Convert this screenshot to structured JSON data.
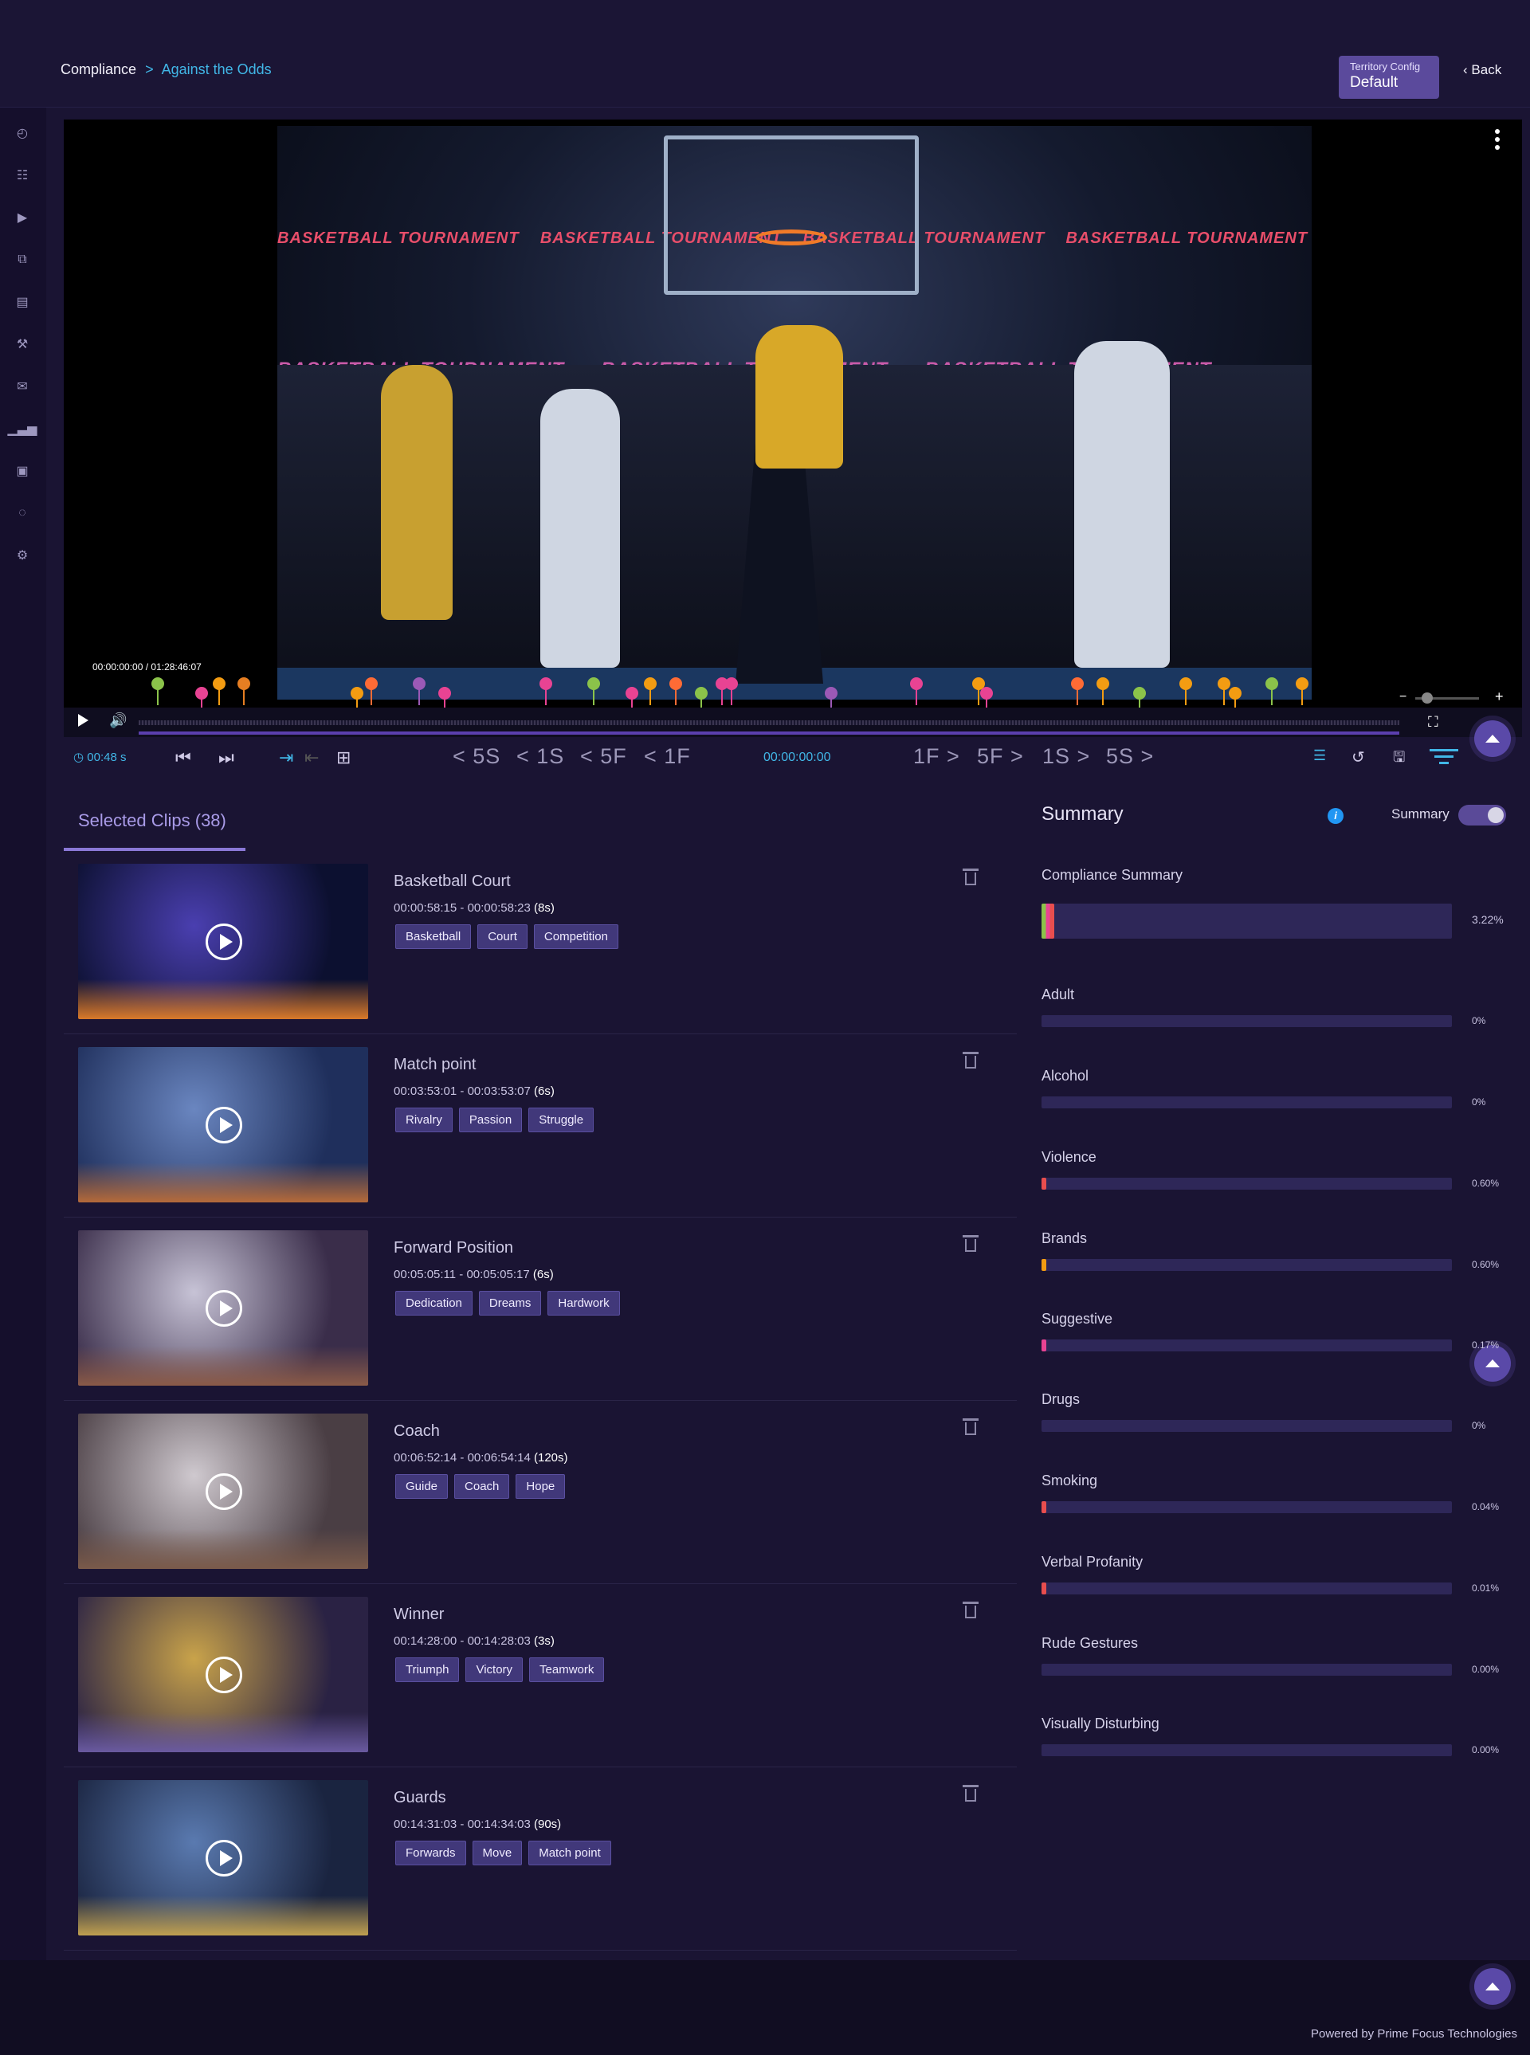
{
  "header": {
    "breadcrumb_root": "Compliance",
    "breadcrumb_sep": ">",
    "breadcrumb_current": "Against the Odds",
    "territory_label": "Territory Config",
    "territory_value": "Default",
    "back_label": "Back"
  },
  "sidebar": {
    "icons": [
      "dashboard-icon",
      "report-icon",
      "video-icon",
      "media-library-icon",
      "catalog-icon",
      "tools-icon",
      "review-icon",
      "analytics-icon",
      "tasks-icon",
      "chat-icon",
      "settings-icon"
    ]
  },
  "player": {
    "time_readout": "00:00:00:00 / 01:28:46:07",
    "banner_text": "BASKETBALL TOURNAMENT",
    "marker_colors": [
      "#8bc34a",
      "#e84393",
      "#f39c12",
      "#e67e22",
      "#f39c12",
      "#ff6b35",
      "#9b59b6",
      "#e84393",
      "#e84393",
      "#8bc34a",
      "#e84393",
      "#f39c12",
      "#ff6b35",
      "#8bc34a",
      "#e84393",
      "#e84393",
      "#9b59b6",
      "#e84393",
      "#f39c12",
      "#e84393",
      "#ff6b35",
      "#f39c12",
      "#8bc34a",
      "#f39c12",
      "#f39c12",
      "#f39c12",
      "#8bc34a",
      "#f39c12"
    ]
  },
  "toolbar": {
    "duration": "00:48 s",
    "seek_back_5s": "< 5S",
    "seek_back_1s": "< 1S",
    "seek_back_5f": "< 5F",
    "seek_back_1f": "< 1F",
    "timecode": "00:00:00:00",
    "seek_fwd_1f": "1F >",
    "seek_fwd_5f": "5F >",
    "seek_fwd_1s": "1S >",
    "seek_fwd_5s": "5S >"
  },
  "clips": {
    "tab_label": "Selected Clips (38)",
    "items": [
      {
        "title": "Basketball Court",
        "range": "00:00:58:15 - 00:00:58:23",
        "dur": "(8s)",
        "tags": [
          "Basketball",
          "Court",
          "Competition"
        ],
        "colors": [
          "#4a3fb0",
          "#0c1030",
          "#d97a2a"
        ]
      },
      {
        "title": "Match point",
        "range": "00:03:53:01 - 00:03:53:07",
        "dur": "(6s)",
        "tags": [
          "Rivalry",
          "Passion",
          "Struggle"
        ],
        "colors": [
          "#6a86c0",
          "#1f2f5c",
          "#b56a3a"
        ]
      },
      {
        "title": "Forward Position",
        "range": "00:05:05:11 - 00:05:05:17",
        "dur": "(6s)",
        "tags": [
          "Dedication",
          "Dreams",
          "Hardwork"
        ],
        "colors": [
          "#c7c3d6",
          "#3a2d4a",
          "#8a5a48"
        ]
      },
      {
        "title": "Coach",
        "range": "00:06:52:14 - 00:06:54:14",
        "dur": "(120s)",
        "tags": [
          "Guide",
          "Coach",
          "Hope"
        ],
        "colors": [
          "#cfc9cf",
          "#4a3e44",
          "#7a5a4a"
        ]
      },
      {
        "title": "Winner",
        "range": "00:14:28:00 - 00:14:28:03",
        "dur": "(3s)",
        "tags": [
          "Triumph",
          "Victory",
          "Teamwork"
        ],
        "colors": [
          "#c9a34a",
          "#2a2244",
          "#6a5aa0"
        ]
      },
      {
        "title": "Guards",
        "range": "00:14:31:03 - 00:14:34:03",
        "dur": "(90s)",
        "tags": [
          "Forwards",
          "Move",
          "Match point"
        ],
        "colors": [
          "#5a7ab0",
          "#1a2440",
          "#c0a050"
        ]
      }
    ]
  },
  "summary": {
    "title": "Summary",
    "toggle_label": "Summary",
    "categories": [
      {
        "label": "Compliance Summary",
        "pct": "3.22%",
        "fill": 0.0322,
        "color": "#e84e4e"
      },
      {
        "label": "Adult",
        "pct": "0%",
        "fill": 0,
        "color": "#e84e4e"
      },
      {
        "label": "Alcohol",
        "pct": "0%",
        "fill": 0,
        "color": "#e84e4e"
      },
      {
        "label": "Violence",
        "pct": "0.60%",
        "fill": 0.006,
        "color": "#e84e4e"
      },
      {
        "label": "Brands",
        "pct": "0.60%",
        "fill": 0.006,
        "color": "#f39c12"
      },
      {
        "label": "Suggestive",
        "pct": "0.17%",
        "fill": 0.0017,
        "color": "#e84393"
      },
      {
        "label": "Drugs",
        "pct": "0%",
        "fill": 0,
        "color": "#e84e4e"
      },
      {
        "label": "Smoking",
        "pct": "0.04%",
        "fill": 0.0004,
        "color": "#e84e4e"
      },
      {
        "label": "Verbal Profanity",
        "pct": "0.01%",
        "fill": 0.0001,
        "color": "#e84e4e"
      },
      {
        "label": "Rude Gestures",
        "pct": "0.00%",
        "fill": 0,
        "color": "#e84e4e"
      },
      {
        "label": "Visually Disturbing",
        "pct": "0.00%",
        "fill": 0,
        "color": "#e84e4e"
      }
    ]
  },
  "footer": {
    "powered_by": "Powered by Prime Focus Technologies"
  }
}
